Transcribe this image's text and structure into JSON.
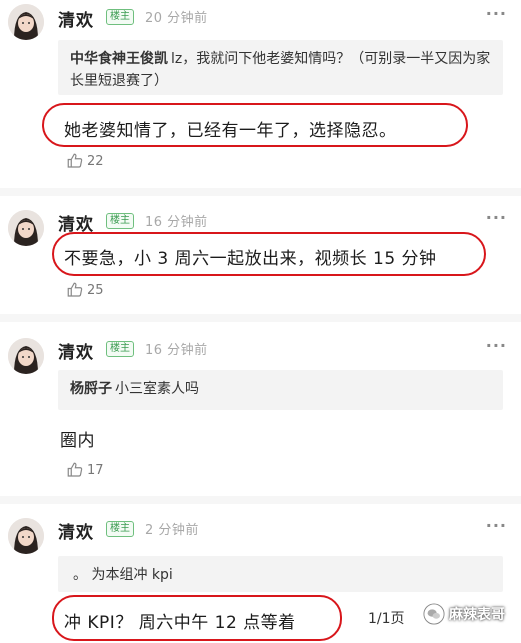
{
  "posts": [
    {
      "username": "清欢",
      "badge": "楼主",
      "time": "20 分钟前",
      "more": "···",
      "quote": {
        "user": "中华食神王俊凯",
        "text": "lz，我就问下他老婆知情吗？（可别录一半又因为家长里短退赛了）"
      },
      "content": "她老婆知情了，已经有一年了，选择隐忍。",
      "likes": "22"
    },
    {
      "username": "清欢",
      "badge": "楼主",
      "time": "16 分钟前",
      "more": "···",
      "content": "不要急，小 3 周六一起放出来，视频长 15 分钟",
      "likes": "25"
    },
    {
      "username": "清欢",
      "badge": "楼主",
      "time": "16 分钟前",
      "more": "···",
      "quote": {
        "user": "杨脟子",
        "text": "小三室素人吗"
      },
      "content": "圈内",
      "likes": "17"
    },
    {
      "username": "清欢",
      "badge": "楼主",
      "time": "2 分钟前",
      "more": "···",
      "quote": {
        "user": "",
        "text": "。 为本组冲 kpi"
      },
      "content": "冲 KPI？ 周六中午 12 点等着"
    }
  ],
  "pager": "1/1页",
  "watermark": "麻辣表哥",
  "colors": {
    "highlight_oval": "#d8161b",
    "badge_green": "#3a9b50"
  }
}
